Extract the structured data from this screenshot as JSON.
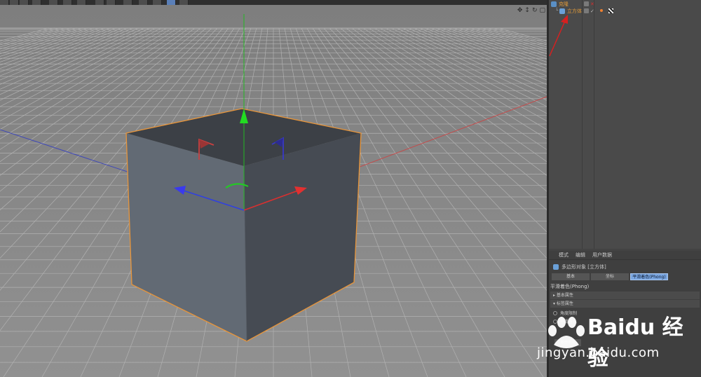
{
  "object_manager": {
    "objects": [
      {
        "name": "克隆"
      },
      {
        "name": "立方体"
      }
    ]
  },
  "attributes": {
    "tabs": [
      "模式",
      "编辑",
      "用户数据"
    ],
    "object_header": "多边形对象 [立方体]",
    "buttons": [
      {
        "label": "基本",
        "active": false
      },
      {
        "label": "坐标",
        "active": false
      },
      {
        "label": "平滑着色(Phong)",
        "active": true
      }
    ],
    "section_title": "平滑着色(Phong)",
    "sections": [
      "基本属性",
      "标签属性"
    ],
    "options": [
      "角度限制",
      "平滑着色"
    ],
    "dim_button": "断开平滑"
  },
  "watermark": {
    "logo_text": "Baidu 经验",
    "url": "jingyan.baidu.com"
  },
  "colors": {
    "viewport_bg": "#8a8a8a",
    "cube_top": "#3d4147",
    "cube_left": "#636a74",
    "cube_right": "#454a52",
    "selection_outline": "#e8953a",
    "axis_y": "#22cc22",
    "axis_x": "#dd3333",
    "axis_z": "#3333dd",
    "annotation_arrow": "#d62020",
    "accent_tab": "#7aa6e0"
  },
  "icons": {
    "viewport_nav": [
      "move-icon",
      "zoom-icon",
      "rotate-icon",
      "maximize-icon"
    ]
  }
}
